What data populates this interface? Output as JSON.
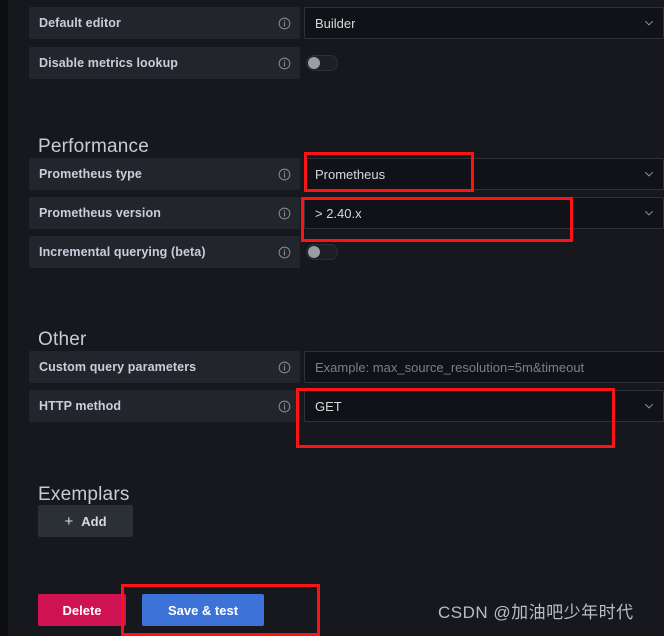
{
  "page": {
    "background": "#16181d",
    "panel_background": "#16181d"
  },
  "colors": {
    "label_bg": "#22252b",
    "label_text": "#ccccdc",
    "input_bg": "#111217",
    "input_border": "#2e3138",
    "value_text": "#d8d9da",
    "placeholder_text": "#7b7f8a",
    "section_title": "#c7ccd4",
    "delete_button": "#cf1252",
    "save_button": "#3d72d6",
    "add_button": "#2b2f36",
    "annotation_red": "#fc1318"
  },
  "top_fields": [
    {
      "label": "Default editor",
      "info_icon": "info-circle-icon",
      "control": "select",
      "value": "Builder",
      "chevron": "chevron-down-icon"
    },
    {
      "label": "Disable metrics lookup",
      "info_icon": "info-circle-icon",
      "control": "toggle",
      "value": "off"
    }
  ],
  "performance": {
    "title": "Performance",
    "fields": [
      {
        "label": "Prometheus type",
        "info_icon": "info-circle-icon",
        "control": "select",
        "value": "Prometheus",
        "chevron": "chevron-down-icon"
      },
      {
        "label": "Prometheus version",
        "info_icon": "info-circle-icon",
        "control": "select",
        "value": "> 2.40.x",
        "chevron": "chevron-down-icon"
      },
      {
        "label": "Incremental querying (beta)",
        "info_icon": "info-circle-icon",
        "control": "toggle",
        "value": "off"
      }
    ]
  },
  "other": {
    "title": "Other",
    "fields": [
      {
        "label": "Custom query parameters",
        "info_icon": "info-circle-icon",
        "control": "text",
        "value": "",
        "placeholder": "Example: max_source_resolution=5m&timeout"
      },
      {
        "label": "HTTP method",
        "info_icon": "info-circle-icon",
        "control": "select",
        "value": "GET",
        "chevron": "chevron-down-icon"
      }
    ]
  },
  "exemplars": {
    "title": "Exemplars",
    "add_button": {
      "plus": "+",
      "label": "Add",
      "icon": "plus-icon"
    }
  },
  "actions": {
    "delete_label": "Delete",
    "save_label": "Save & test"
  },
  "watermark": {
    "text": "CSDN @加油吧少年时代"
  },
  "annotations": [
    {
      "name": "prometheus-type-highlight"
    },
    {
      "name": "prometheus-version-highlight"
    },
    {
      "name": "http-method-highlight"
    },
    {
      "name": "save-test-highlight"
    }
  ]
}
